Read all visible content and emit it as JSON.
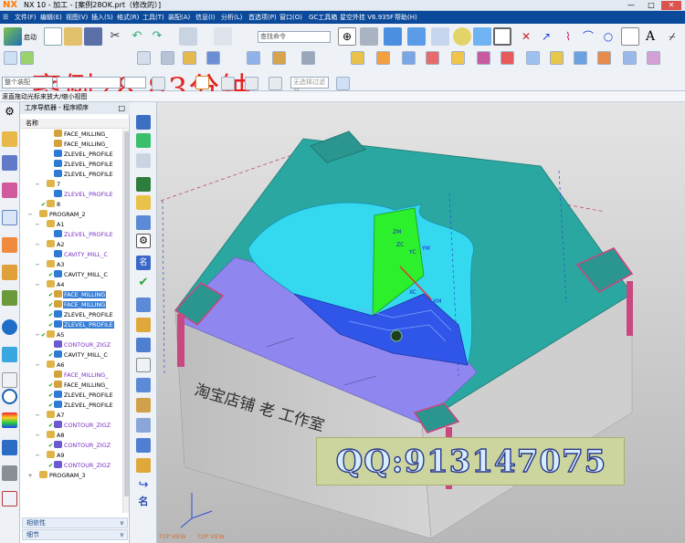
{
  "window": {
    "logo": "NX",
    "title": "NX 10 - 加工 - [案例28OK.prt（修改的）]",
    "controls": [
      "—",
      "□",
      "✕"
    ]
  },
  "menubar": {
    "items": [
      "文件(F)",
      "编辑(E)",
      "视图(V)",
      "插入(S)",
      "格式(R)",
      "工具(T)",
      "装配(A)",
      "信息(I)",
      "分析(L)",
      "首选项(P)",
      "窗口(O)",
      "GC工具箱",
      "星空外挂 V6.935F",
      "帮助(H)"
    ]
  },
  "toolbar": {
    "start_label": "启动",
    "search_placeholder": "查找命令",
    "overlay_text": "案例28   83分钟",
    "selection_filter": "整个装配",
    "snap_label": "无选择过滤器"
  },
  "status": {
    "text": "滚直拖动光标来放大/缩小视图"
  },
  "navigator": {
    "title": "工序导航器 - 程序顺序",
    "column": "名称",
    "rows": [
      {
        "indent": 3,
        "glyph": "",
        "check": "",
        "check_color": "#888888",
        "icon": "face",
        "label": "FACE_MILLING_",
        "color": "#000000",
        "selected": false
      },
      {
        "indent": 3,
        "glyph": "",
        "check": "",
        "check_color": "#888888",
        "icon": "face",
        "label": "FACE_MILLING_",
        "color": "#000000",
        "selected": false
      },
      {
        "indent": 3,
        "glyph": "",
        "check": "",
        "check_color": "#888888",
        "icon": "zlevel",
        "label": "ZLEVEL_PROFILE",
        "color": "#000000",
        "selected": false
      },
      {
        "indent": 3,
        "glyph": "",
        "check": "",
        "check_color": "#888888",
        "icon": "zlevel",
        "label": "ZLEVEL_PROFILE",
        "color": "#000000",
        "selected": false
      },
      {
        "indent": 3,
        "glyph": "",
        "check": "",
        "check_color": "#888888",
        "icon": "zlevel",
        "label": "ZLEVEL_PROFILE",
        "color": "#000000",
        "selected": false
      },
      {
        "indent": 2,
        "glyph": "−",
        "check": "",
        "check_color": "#888888",
        "icon": "group",
        "label": "7",
        "color": "#000000",
        "selected": false
      },
      {
        "indent": 3,
        "glyph": "",
        "check": "",
        "check_color": "#888888",
        "icon": "zlevel",
        "label": "ZLEVEL_PROFILE",
        "color": "#7a2fc5",
        "selected": false
      },
      {
        "indent": 2,
        "glyph": "",
        "check": "✔",
        "check_color": "#1a9b1a",
        "icon": "group",
        "label": "8",
        "color": "#000000",
        "selected": false
      },
      {
        "indent": 1,
        "glyph": "−",
        "check": "",
        "check_color": "#888888",
        "icon": "group",
        "label": "PROGRAM_2",
        "color": "#000000",
        "selected": false
      },
      {
        "indent": 2,
        "glyph": "−",
        "check": "",
        "check_color": "#888888",
        "icon": "group",
        "label": "A1",
        "color": "#000000",
        "selected": false
      },
      {
        "indent": 3,
        "glyph": "",
        "check": "",
        "check_color": "#888888",
        "icon": "zlevel",
        "label": "ZLEVEL_PROFILE",
        "color": "#7a2fc5",
        "selected": false
      },
      {
        "indent": 2,
        "glyph": "−",
        "check": "",
        "check_color": "#888888",
        "icon": "group",
        "label": "A2",
        "color": "#000000",
        "selected": false
      },
      {
        "indent": 3,
        "glyph": "",
        "check": "",
        "check_color": "#888888",
        "icon": "cavity",
        "label": "CAVITY_MILL_C",
        "color": "#7a2fc5",
        "selected": false
      },
      {
        "indent": 2,
        "glyph": "−",
        "check": "",
        "check_color": "#888888",
        "icon": "group",
        "label": "A3",
        "color": "#000000",
        "selected": false
      },
      {
        "indent": 3,
        "glyph": "",
        "check": "✔",
        "check_color": "#1a9b1a",
        "icon": "cavity",
        "label": "CAVITY_MILL_C",
        "color": "#000000",
        "selected": false
      },
      {
        "indent": 2,
        "glyph": "−",
        "check": "",
        "check_color": "#888888",
        "icon": "group",
        "label": "A4",
        "color": "#000000",
        "selected": false
      },
      {
        "indent": 3,
        "glyph": "",
        "check": "✔",
        "check_color": "#1a9b1a",
        "icon": "face",
        "label": "FACE_MILLING",
        "color": "#000000",
        "selected": true
      },
      {
        "indent": 3,
        "glyph": "",
        "check": "✔",
        "check_color": "#1a9b1a",
        "icon": "face",
        "label": "FACE_MILLING",
        "color": "#000000",
        "selected": true
      },
      {
        "indent": 3,
        "glyph": "",
        "check": "✔",
        "check_color": "#1a9b1a",
        "icon": "zlevel",
        "label": "ZLEVEL_PROFILE",
        "color": "#000000",
        "selected": false
      },
      {
        "indent": 3,
        "glyph": "",
        "check": "✔",
        "check_color": "#1a9b1a",
        "icon": "zlevel",
        "label": "ZLEVEL_PROFILE",
        "color": "#000000",
        "selected": true
      },
      {
        "indent": 2,
        "glyph": "−",
        "check": "✔",
        "check_color": "#1a9b1a",
        "icon": "group",
        "label": "A5",
        "color": "#000000",
        "selected": false
      },
      {
        "indent": 3,
        "glyph": "",
        "check": "",
        "check_color": "#888888",
        "icon": "contour",
        "label": "CONTOUR_ZIGZ",
        "color": "#7a2fc5",
        "selected": false
      },
      {
        "indent": 3,
        "glyph": "",
        "check": "✔",
        "check_color": "#1a9b1a",
        "icon": "cavity",
        "label": "CAVITY_MILL_C",
        "color": "#000000",
        "selected": false
      },
      {
        "indent": 2,
        "glyph": "−",
        "check": "",
        "check_color": "#888888",
        "icon": "group",
        "label": "A6",
        "color": "#000000",
        "selected": false
      },
      {
        "indent": 3,
        "glyph": "",
        "check": "",
        "check_color": "#888888",
        "icon": "face",
        "label": "FACE_MILLING_",
        "color": "#7a2fc5",
        "selected": false
      },
      {
        "indent": 3,
        "glyph": "",
        "check": "✔",
        "check_color": "#1a9b1a",
        "icon": "face",
        "label": "FACE_MILLING_",
        "color": "#000000",
        "selected": false
      },
      {
        "indent": 3,
        "glyph": "",
        "check": "✔",
        "check_color": "#1a9b1a",
        "icon": "zlevel",
        "label": "ZLEVEL_PROFILE",
        "color": "#000000",
        "selected": false
      },
      {
        "indent": 3,
        "glyph": "",
        "check": "✔",
        "check_color": "#1a9b1a",
        "icon": "zlevel",
        "label": "ZLEVEL_PROFILE",
        "color": "#000000",
        "selected": false
      },
      {
        "indent": 2,
        "glyph": "−",
        "check": "",
        "check_color": "#888888",
        "icon": "group",
        "label": "A7",
        "color": "#000000",
        "selected": false
      },
      {
        "indent": 3,
        "glyph": "",
        "check": "✔",
        "check_color": "#1a9b1a",
        "icon": "contour",
        "label": "CONTOUR_ZIGZ",
        "color": "#7a2fc5",
        "selected": false
      },
      {
        "indent": 2,
        "glyph": "−",
        "check": "",
        "check_color": "#888888",
        "icon": "group",
        "label": "A8",
        "color": "#000000",
        "selected": false
      },
      {
        "indent": 3,
        "glyph": "",
        "check": "✔",
        "check_color": "#1a9b1a",
        "icon": "contour",
        "label": "CONTOUR_ZIGZ",
        "color": "#7a2fc5",
        "selected": false
      },
      {
        "indent": 2,
        "glyph": "−",
        "check": "",
        "check_color": "#888888",
        "icon": "group",
        "label": "A9",
        "color": "#000000",
        "selected": false
      },
      {
        "indent": 3,
        "glyph": "",
        "check": "✔",
        "check_color": "#1a9b1a",
        "icon": "contour",
        "label": "CONTOUR_ZIGZ",
        "color": "#7a2fc5",
        "selected": false
      },
      {
        "indent": 1,
        "glyph": "+",
        "check": "",
        "check_color": "#888888",
        "icon": "group",
        "label": "PROGRAM_3",
        "color": "#000000",
        "selected": false
      }
    ],
    "panel_dependencies": "相依性",
    "panel_details": "细节"
  },
  "viewport": {
    "engraving": "淘宝店铺 老   工作室",
    "qq_text": "QQ:913147075",
    "view_labels": [
      "TOP VIEW",
      "TOP VIEW"
    ],
    "axis_labels": [
      "ZM",
      "YM",
      "XM",
      "ZC",
      "YC",
      "XC"
    ]
  },
  "colors": {
    "menubar": "#0b4a9b",
    "part_teal": "#2aa7a0",
    "cavity_cyan": "#34d8ef",
    "floor_blue": "#2f56e8",
    "wall_green": "#2cf02c",
    "shoulder_purple": "#8f86ef",
    "corner_magenta": "#c8487f",
    "selection": "#3a7fd5"
  }
}
